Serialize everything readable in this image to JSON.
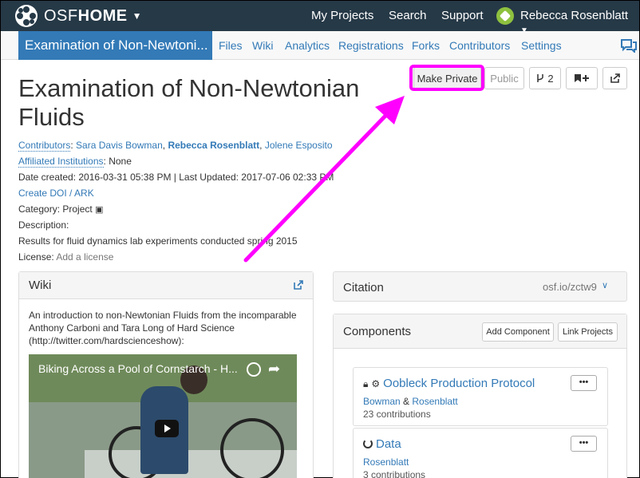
{
  "topnav": {
    "brand_osf": "OSF",
    "brand_home": "HOME",
    "links": [
      "My Projects",
      "Search",
      "Support"
    ],
    "user_name": "Rebecca Rosenblatt"
  },
  "projnav": {
    "title": "Examination of Non-Newtoni...",
    "tabs": [
      "Files",
      "Wiki",
      "Analytics",
      "Registrations",
      "Forks",
      "Contributors",
      "Settings"
    ]
  },
  "project": {
    "title": "Examination of Non-Newtonian Fluids",
    "buttons": {
      "make_private": "Make Private",
      "public": "Public",
      "fork_count": "2"
    },
    "contributors_label": "Contributors",
    "contributors": [
      "Sara Davis Bowman",
      "Rebecca Rosenblatt",
      "Jolene Esposito"
    ],
    "affiliated_label": "Affiliated Institutions",
    "affiliated_value": "None",
    "dates": "Date created: 2016-03-31 05:38 PM | Last Updated: 2017-07-06 02:33 PM",
    "create_doi": "Create DOI / ARK",
    "category": "Category: Project",
    "description_label": "Description:",
    "description": "Results for fluid dynamics lab experiments conducted spring 2015",
    "license_label": "License:",
    "license_link": "Add a license"
  },
  "wiki": {
    "title": "Wiki",
    "text": "An introduction to non-Newtonian Fluids from the incomparable Anthony Carboni and Tara Long of Hard Science (http://twitter.com/hardscienceshow):",
    "video_title": "Biking Across a Pool of Cornstarch - H..."
  },
  "citation": {
    "label": "Citation",
    "url": "osf.io/zctw9"
  },
  "components": {
    "label": "Components",
    "add_button": "Add Component",
    "link_button": "Link Projects",
    "items": [
      {
        "title": "Oobleck Production Protocol",
        "author1": "Bowman",
        "amp": "&",
        "author2": "Rosenblatt",
        "contributions": "23 contributions",
        "menu": "•••"
      },
      {
        "title": "Data",
        "author1": "Rosenblatt",
        "contributions": "3 contributions",
        "menu": "•••"
      }
    ]
  },
  "colors": {
    "topnav_bg": "#263947",
    "accent_blue": "#337ab7",
    "highlight_magenta": "#ff00ff"
  }
}
